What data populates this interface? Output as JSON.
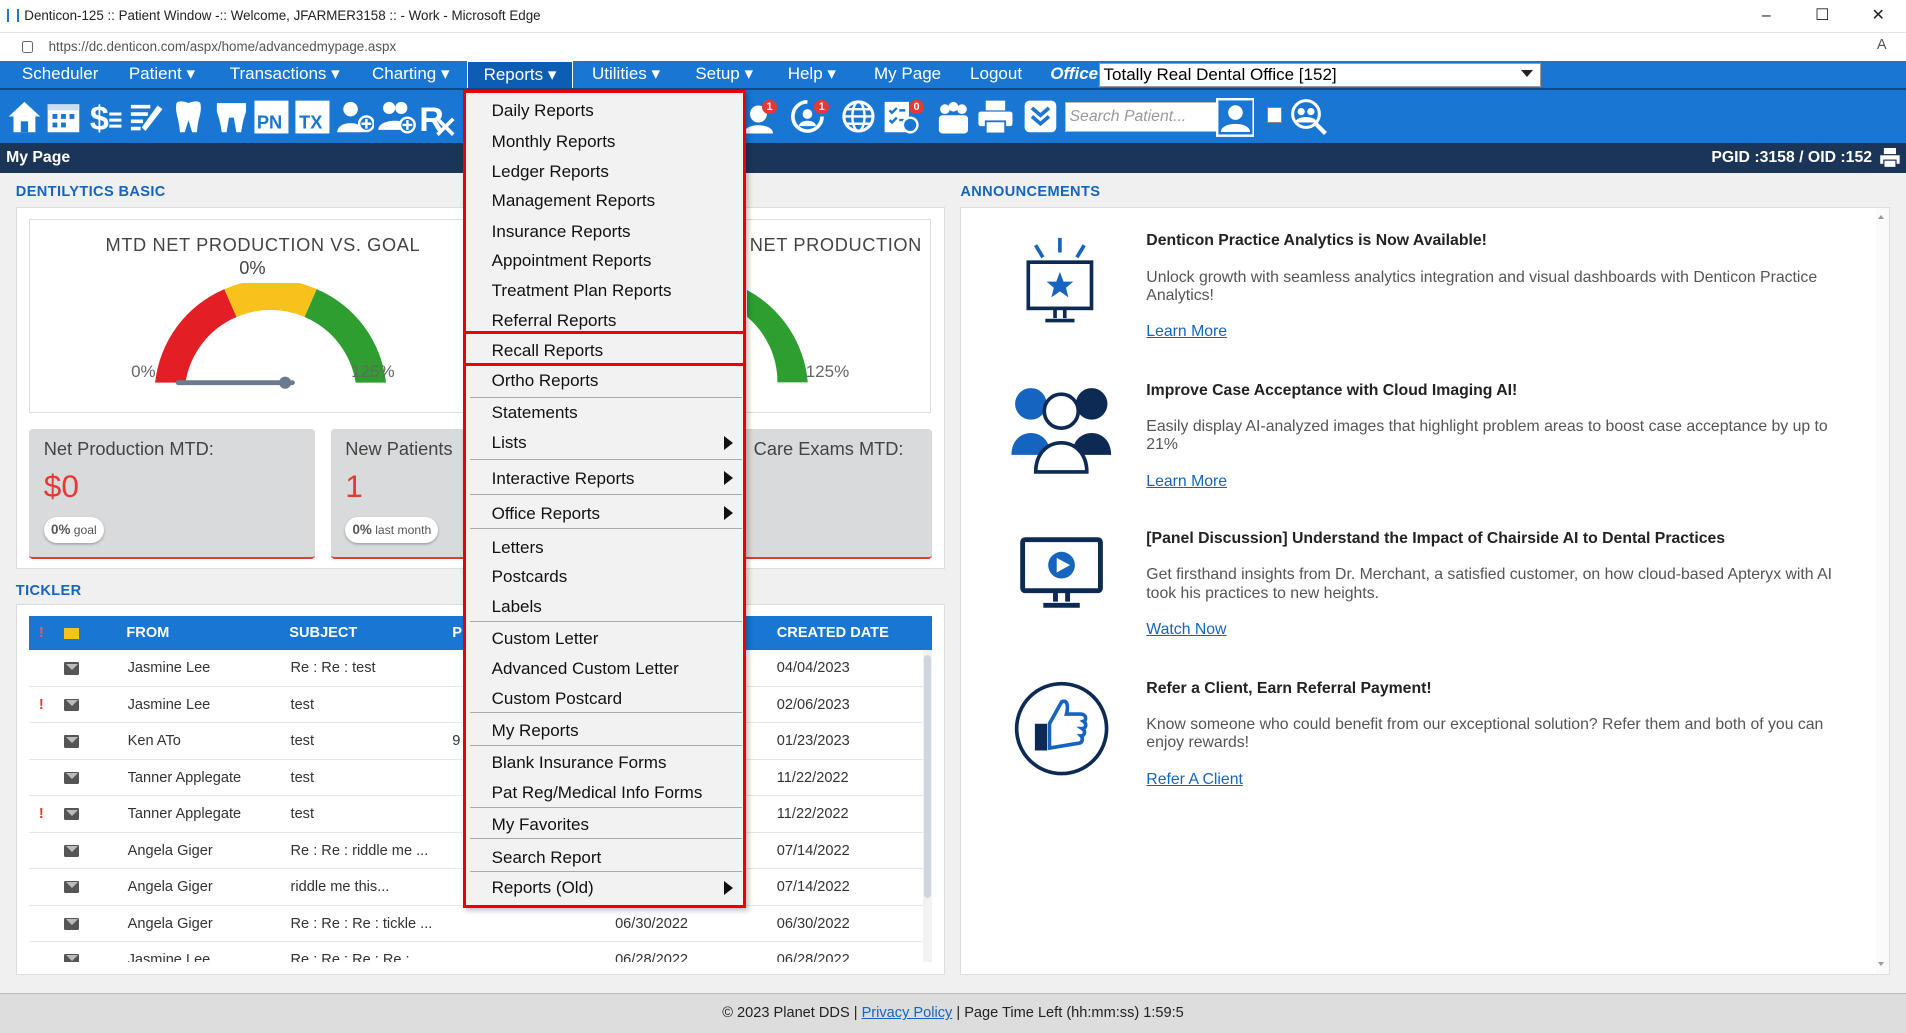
{
  "browser": {
    "title": "Denticon-125 :: Patient Window -:: Welcome, JFARMER3158 :: - Work - Microsoft Edge",
    "url": "https://dc.denticon.com/aspx/home/advancedmypage.aspx",
    "minimize": "–",
    "maximize": "☐",
    "close": "✕"
  },
  "nav": {
    "scheduler": "Scheduler",
    "patient": "Patient ▾",
    "transactions": "Transactions ▾",
    "charting": "Charting ▾",
    "reports": "Reports ▾",
    "utilities": "Utilities ▾",
    "setup": "Setup ▾",
    "help": "Help ▾",
    "mypage": "My Page",
    "logout": "Logout",
    "office_label": "Office",
    "office_value": "Totally Real Dental Office [152]"
  },
  "toolbar": {
    "search_placeholder": "Search Patient...",
    "badge1": "1",
    "badge2": "1",
    "badge3": "0"
  },
  "page": {
    "title": "My Page",
    "ids": "PGID :3158  /  OID :152"
  },
  "dentilytics": {
    "heading": "DENTILYTICS BASIC",
    "gauge1_title": "MTD NET PRODUCTION VS. GOAL",
    "gauge1_value": "0%",
    "gauge1_min": "0%",
    "gauge1_max": "125%",
    "gauge2_title": "NET PRODUCTION",
    "gauge2_max": "125%",
    "kpi1_label": "Net Production MTD:",
    "kpi1_value": "$0",
    "kpi1_pill_pct": "0%",
    "kpi1_pill_txt": "goal",
    "kpi2_label": "New Patients",
    "kpi2_value": "1",
    "kpi2_pill_pct": "0%",
    "kpi2_pill_txt": "last month",
    "kpi3_label": "Care Exams MTD:"
  },
  "tickler": {
    "heading": "TICKLER",
    "columns": [
      "FROM",
      "SUBJECT",
      "P",
      "CREATED DATE"
    ],
    "rows": [
      {
        "flag": "",
        "from": "Jasmine Lee",
        "subject": "Re : Re : test",
        "extra": "",
        "created": "04/04/2023"
      },
      {
        "flag": "!",
        "from": "Jasmine Lee",
        "subject": "test",
        "extra": "",
        "created": "02/06/2023"
      },
      {
        "flag": "",
        "from": "Ken ATo",
        "subject": "test",
        "extra": "9",
        "created": "01/23/2023"
      },
      {
        "flag": "",
        "from": "Tanner Applegate",
        "subject": "test",
        "extra": "",
        "created": "11/22/2022"
      },
      {
        "flag": "!",
        "from": "Tanner Applegate",
        "subject": "test",
        "extra": "",
        "created": "11/22/2022"
      },
      {
        "flag": "",
        "from": "Angela Giger",
        "subject": "Re : Re : riddle me ...",
        "extra": "",
        "created": "07/14/2022"
      },
      {
        "flag": "",
        "from": "Angela Giger",
        "subject": "riddle me this...",
        "extra": "",
        "created": "07/14/2022"
      },
      {
        "flag": "",
        "from": "Angela Giger",
        "subject": "Re : Re : Re : tickle ...",
        "extra": "06/30/2022",
        "created": "06/30/2022"
      },
      {
        "flag": "",
        "from": "Jasmine Lee",
        "subject": "Re : Re : Re : Re :",
        "extra": "06/28/2022",
        "created": "06/28/2022"
      }
    ]
  },
  "announcements": {
    "heading": "ANNOUNCEMENTS",
    "items": [
      {
        "title": "Denticon Practice Analytics is Now Available!",
        "body": "Unlock growth with seamless analytics integration and visual dashboards with Denticon Practice Analytics!",
        "link": "Learn More"
      },
      {
        "title": "Improve Case Acceptance with Cloud Imaging AI!",
        "body": "Easily display AI-analyzed images that highlight problem areas to boost case acceptance by up to 21%",
        "link": "Learn More"
      },
      {
        "title": "[Panel Discussion] Understand the Impact of Chairside AI to Dental Practices",
        "body": "Get firsthand insights from Dr. Merchant, a satisfied customer, on how cloud-based Apteryx with AI took his practices to new heights.",
        "link": "Watch Now"
      },
      {
        "title": "Refer a Client, Earn Referral Payment!",
        "body": "Know someone who could benefit from our exceptional solution? Refer them and both of you can enjoy rewards!",
        "link": "Refer A Client"
      }
    ]
  },
  "reports_menu": {
    "items": [
      "Daily Reports",
      "Monthly Reports",
      "Ledger Reports",
      "Management Reports",
      "Insurance Reports",
      "Appointment Reports",
      "Treatment Plan Reports",
      "Referral Reports",
      "Recall Reports",
      "Ortho Reports",
      "Statements",
      "Lists",
      "Interactive Reports",
      "Office Reports",
      "Letters",
      "Postcards",
      "Labels",
      "Custom Letter",
      "Advanced Custom Letter",
      "Custom Postcard",
      "My Reports",
      "Blank Insurance Forms",
      "Pat Reg/Medical Info Forms",
      "My Favorites",
      "Search Report",
      "Reports (Old)"
    ]
  },
  "footer": {
    "copyright": "© 2023 Planet DDS |",
    "privacy": "Privacy Policy",
    "time_left": "| Page Time Left (hh:mm:ss) 1:59:5"
  },
  "colors": {
    "nav_blue": "#1976d2",
    "dark_bar": "#1b3558",
    "highlight_red": "#ee0000",
    "accent_red": "#e53935"
  }
}
